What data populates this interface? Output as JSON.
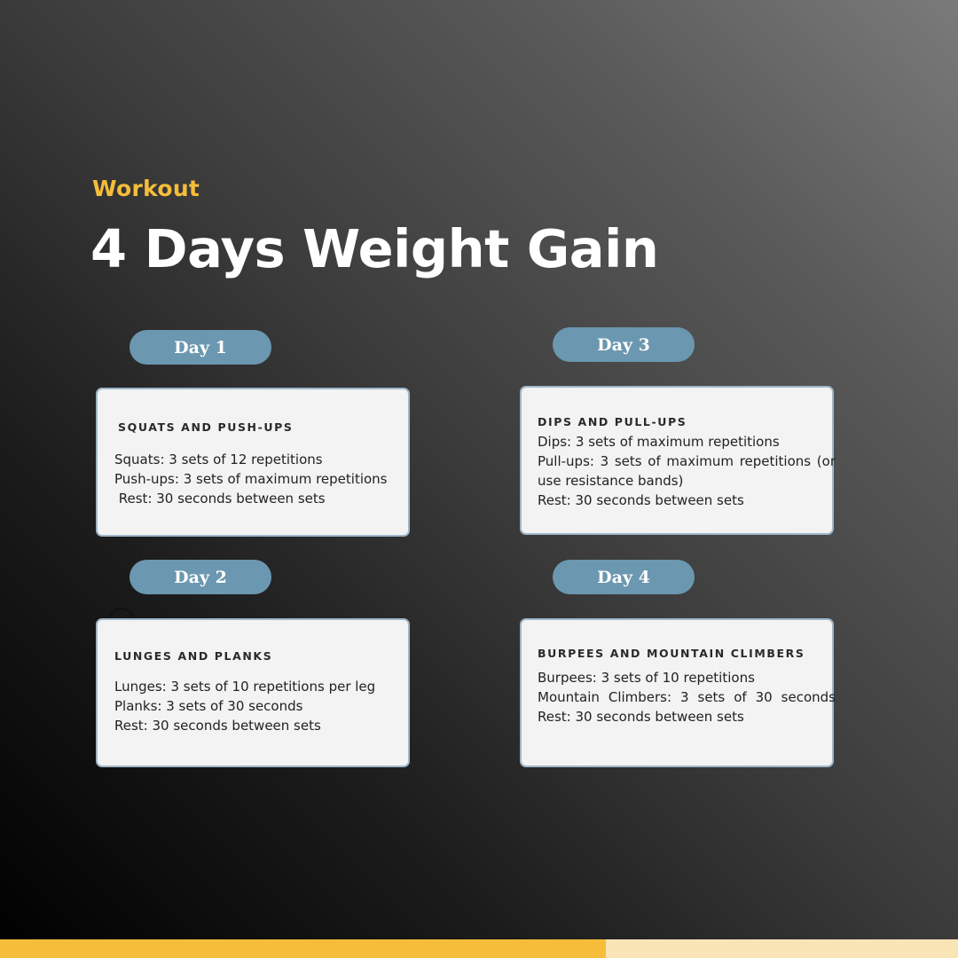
{
  "header": {
    "eyebrow": "Workout",
    "title": "4 Days Weight Gain"
  },
  "days": [
    {
      "label": "Day 1",
      "heading": "SQUATS AND PUSH-UPS",
      "lines": [
        "Squats: 3 sets of 12 repetitions",
        "Push-ups: 3 sets of maximum repetitions",
        " Rest: 30 seconds between sets"
      ]
    },
    {
      "label": "Day 2",
      "heading": "LUNGES AND PLANKS",
      "lines": [
        "Lunges: 3 sets of 10 repetitions per leg",
        "Planks: 3 sets of 30 seconds",
        "Rest: 30 seconds between sets"
      ]
    },
    {
      "label": "Day 3",
      "heading": "DIPS AND PULL-UPS",
      "lines": [
        "Dips: 3 sets of maximum repetitions",
        "Pull-ups: 3 sets of maximum repetitions (or use resistance bands)",
        "Rest: 30 seconds between sets"
      ]
    },
    {
      "label": "Day 4",
      "heading": "BURPEES AND MOUNTAIN CLIMBERS",
      "lines": [
        "Burpees: 3 sets of 10 repetitions",
        "Mountain Climbers: 3 sets of 30 seconds",
        "Rest: 30 seconds between sets"
      ]
    }
  ],
  "colors": {
    "accent": "#f5bd3a",
    "accent_light": "#f9e4b5",
    "pill": "#6b97b0",
    "card_background": "#f3f3f3",
    "card_border": "#9fb6c8"
  }
}
